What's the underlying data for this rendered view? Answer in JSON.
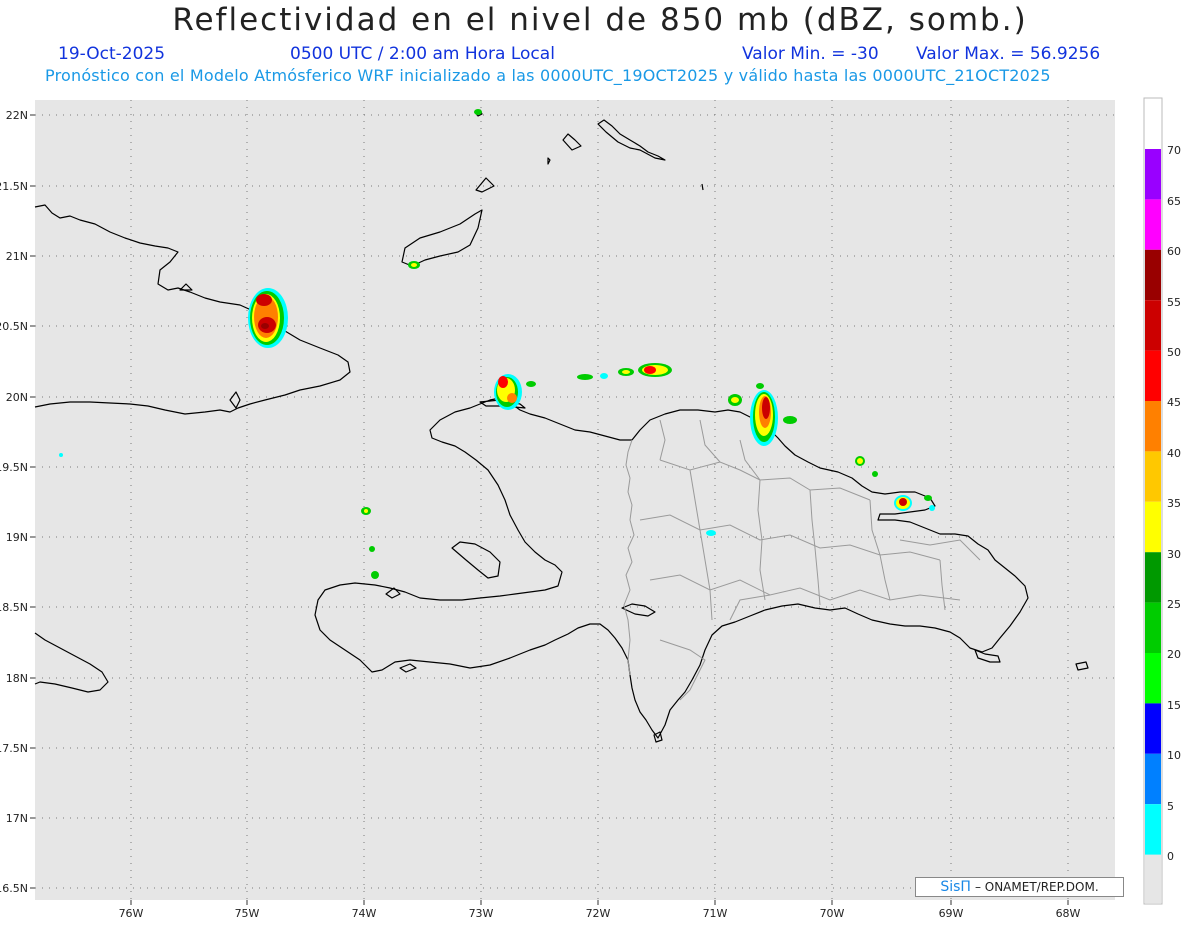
{
  "header": {
    "title": "Reflectividad en el nivel de 850 mb (dBZ, somb.)",
    "date": "19-Oct-2025",
    "time": "0500 UTC / 2:00 am Hora Local",
    "min_label": "Valor Min. = -30",
    "max_label": "Valor Max. = 56.9256",
    "model_line": "Pronóstico con el Modelo Atmósferico WRF inicializado a las 0000UTC_19OCT2025 y válido hasta las  0000UTC_21OCT2025"
  },
  "axes": {
    "lat_labels": [
      "22N",
      "21.5N",
      "21N",
      "20.5N",
      "20N",
      "19.5N",
      "19N",
      "18.5N",
      "18N",
      "17.5N",
      "17N",
      "16.5N"
    ],
    "lon_labels": [
      "76W",
      "75W",
      "74W",
      "73W",
      "72W",
      "71W",
      "70W",
      "69W",
      "68W"
    ]
  },
  "colorbar": {
    "ticks": [
      "70",
      "65",
      "60",
      "55",
      "50",
      "45",
      "40",
      "35",
      "30",
      "25",
      "20",
      "15",
      "10",
      "5",
      "0"
    ],
    "colors": [
      "#9900ff",
      "#ff00ff",
      "#990000",
      "#cc0000",
      "#ff0000",
      "#ff8000",
      "#ffc800",
      "#ffff00",
      "#009900",
      "#00cc00",
      "#00ff00",
      "#0000ff",
      "#0080ff",
      "#00ffff"
    ]
  },
  "credit": {
    "sis": "SisΠ",
    "org": "– ONAMET/REP.DOM."
  },
  "colors": {
    "map_bg": "#e6e6e6",
    "coast": "#000000",
    "borders": "#9a9a9a",
    "title_blue": "#1133dd",
    "model_line_blue": "#1a99e6"
  }
}
